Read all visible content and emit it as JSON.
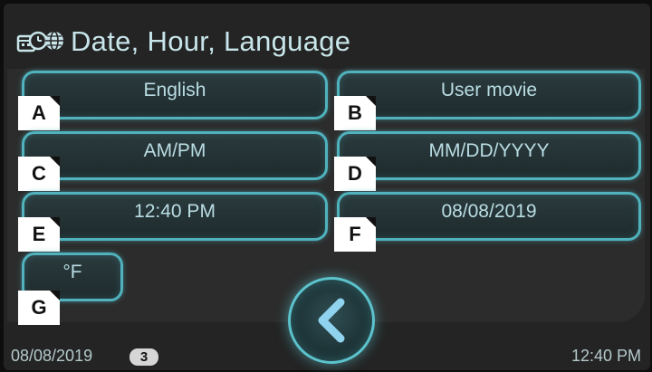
{
  "header": {
    "title": "Date, Hour, Language",
    "icon": "date-language-icon"
  },
  "settings": {
    "language": {
      "value": "English",
      "key": "A"
    },
    "startup": {
      "value": "User movie",
      "key": "B"
    },
    "time_format": {
      "value": "AM/PM",
      "key": "C"
    },
    "date_format": {
      "value": "MM/DD/YYYY",
      "key": "D"
    },
    "time": {
      "value": "12:40 PM",
      "key": "E"
    },
    "date": {
      "value": "08/08/2019",
      "key": "F"
    },
    "temperature_unit": {
      "value": "°F",
      "key": "G"
    }
  },
  "back_button": {
    "icon": "chevron-left-icon"
  },
  "status_bar": {
    "date": "08/08/2019",
    "badge": "3",
    "time": "12:40 PM"
  },
  "colors": {
    "accent": "#4fb2bd",
    "background": "#242424",
    "text": "#b9dde3"
  }
}
